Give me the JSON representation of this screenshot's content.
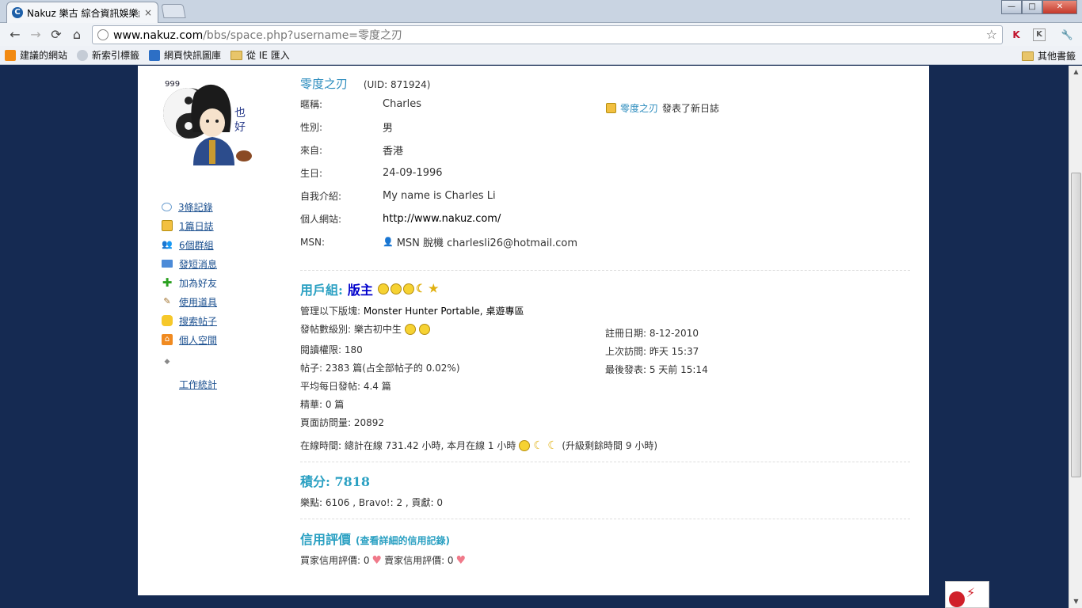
{
  "browser": {
    "tab_title": "Nakuz 樂古 綜合資訊娛樂網",
    "tab_close": "×",
    "url_host": "www.nakuz.com",
    "url_path": "/bbs/space.php?username=零度之刃",
    "window_buttons": {
      "minimize": "—",
      "maximize": "□",
      "close": "✕"
    },
    "bookmarks": [
      {
        "label": "建議的網站",
        "color": "#f28a12"
      },
      {
        "label": "新索引標籤",
        "color": "#9aa4b0"
      },
      {
        "label": "網頁快訊圖庫",
        "color": "#2d6fc5"
      },
      {
        "label": "從 IE 匯入",
        "color": "#e8c56a"
      }
    ],
    "other_bookmarks": "其他書籤"
  },
  "profile": {
    "username": "零度之刃",
    "uid": "(UID: 871924)",
    "fields": [
      {
        "label": "暱稱:",
        "value": "Charles"
      },
      {
        "label": "性別:",
        "value": "男"
      },
      {
        "label": "來自:",
        "value": "香港"
      },
      {
        "label": "生日:",
        "value": "24-09-1996"
      },
      {
        "label": "自我介紹:",
        "value": "My name is Charles Li"
      },
      {
        "label": "個人網站:",
        "value": "http://www.nakuz.com/"
      },
      {
        "label": "MSN:",
        "value": "MSN 脫機 charlesli26@hotmail.com"
      }
    ]
  },
  "feed": {
    "user": "零度之刃",
    "action": "發表了新日誌"
  },
  "leftnav": [
    {
      "label": "3條記錄",
      "icon": "speech-bubble-icon"
    },
    {
      "label": "1篇日誌",
      "icon": "journal-icon"
    },
    {
      "label": "6個群組",
      "icon": "group-icon"
    },
    {
      "label": "發短消息",
      "icon": "envelope-icon"
    },
    {
      "label": "加為好友",
      "icon": "plus-icon"
    },
    {
      "label": "使用道具",
      "icon": "wand-icon"
    },
    {
      "label": "搜索帖子",
      "icon": "search-posts-icon"
    },
    {
      "label": "個人空間",
      "icon": "home-icon"
    },
    {
      "label": "工作統計",
      "icon": "stats-icon"
    }
  ],
  "group": {
    "heading": "用戶組:",
    "name": "版主",
    "moderates_label": "管理以下版塊:",
    "moderates_value": "Monster Hunter Portable, 桌遊專區",
    "post_level": "發帖數級別: 樂古初中生",
    "read_perm": "閱讀權限: 180",
    "posts": "帖子: 2383 篇(占全部帖子的 0.02%)",
    "avg_posts": "平均每日發帖: 4.4 篇",
    "digest": "精華: 0 篇",
    "page_views": "頁面訪問量: 20892",
    "online": "在線時間: 總計在線 731.42 小時, 本月在線 1 小時",
    "upgrade": "(升級剩餘時間 9 小時)",
    "reg_date": "註冊日期: 8-12-2010",
    "last_visit": "上次訪問: 昨天 15:37",
    "last_post": "最後發表: 5 天前 15:14"
  },
  "credits": {
    "heading": "積分: 7818",
    "detail": "樂點: 6106 , Bravo!: 2 , 貢獻: 0"
  },
  "reputation": {
    "heading": "信用評價",
    "link": "(查看詳細的信用記錄)",
    "buyer": "買家信用評價: 0",
    "seller": "賣家信用評價: 0"
  }
}
